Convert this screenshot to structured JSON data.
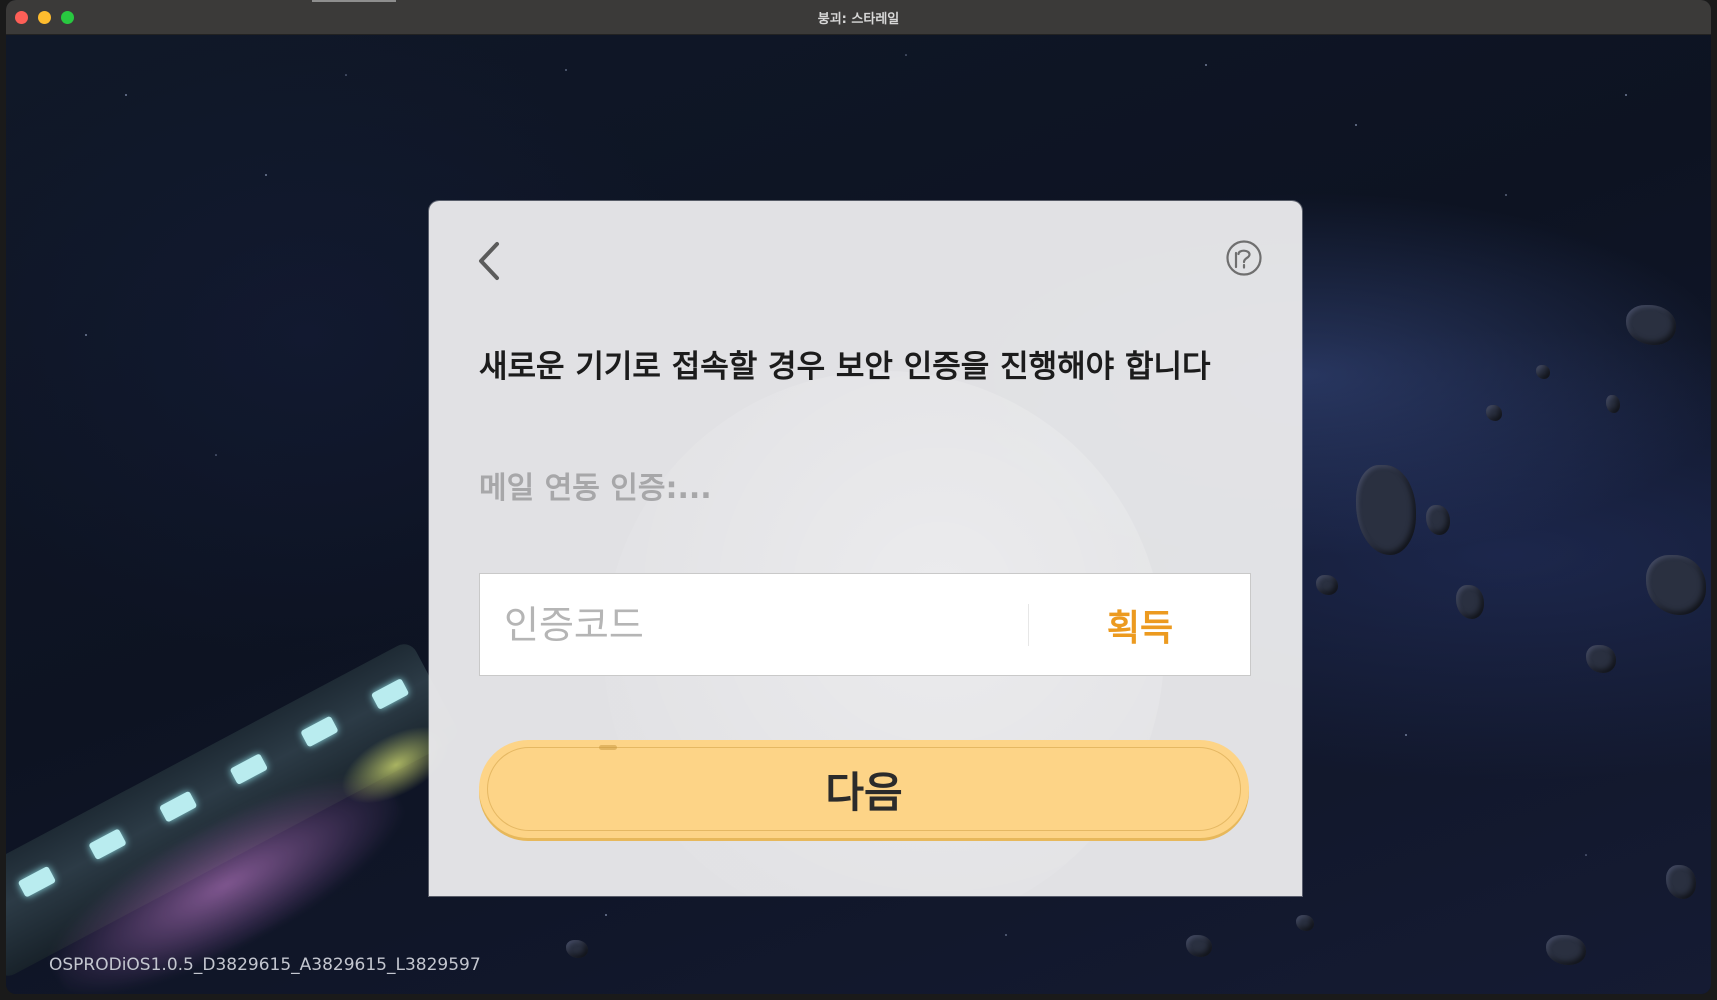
{
  "window": {
    "title": "붕괴: 스타레일"
  },
  "dialog": {
    "headline": "새로운 기기로 접속할 경우 보안 인증을 진행해야 합니다",
    "subline": "메일 연동 인증:...",
    "code_placeholder": "인증코드",
    "get_code_label": "획득",
    "next_label": "다음",
    "icons": {
      "back": "chevron-left-icon",
      "help": "help-circle-icon"
    },
    "accent_color": "#ec9a1f",
    "button_color": "#fdd487"
  },
  "footer": {
    "version": "OSPRODiOS1.0.5_D3829615_A3829615_L3829597"
  }
}
